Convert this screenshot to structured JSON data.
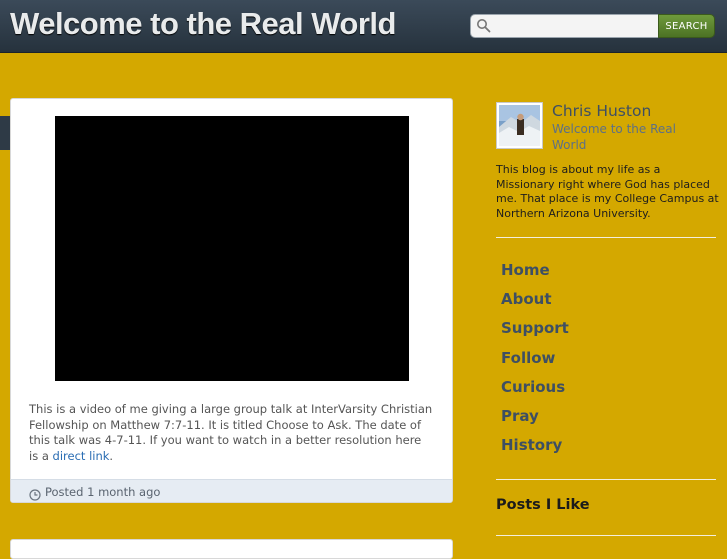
{
  "header": {
    "site_title": "Welcome to the Real World",
    "search": {
      "placeholder": "",
      "value": "",
      "button_label": "SEARCH"
    }
  },
  "post": {
    "body_text": "This is a video of me giving a large group talk at InterVarsity Christian Fellowship on Matthew 7:7-11. It is titled Choose to Ask. The date of this talk was 4-7-11. If you want to watch in a better resolution here is a ",
    "link_text": "direct link",
    "trailing_text": ".",
    "posted": "Posted 1 month ago"
  },
  "sidebar": {
    "author_name": "Chris Huston",
    "author_subtitle": "Welcome to the Real World",
    "bio": "This blog is about my life as a Missionary right where God has placed me. That place is my College Campus at Northern Arizona University.",
    "nav": [
      {
        "label": "Home"
      },
      {
        "label": "About"
      },
      {
        "label": "Support"
      },
      {
        "label": "Follow"
      },
      {
        "label": "Curious"
      },
      {
        "label": "Pray"
      },
      {
        "label": "History"
      }
    ],
    "posts_i_like_heading": "Posts I Like"
  },
  "icons": {
    "search": "search-icon",
    "clock": "clock-icon"
  },
  "colors": {
    "background": "#d4a800",
    "header": "#26323d",
    "accent_button": "#5a8330",
    "link": "#2a6db3"
  }
}
